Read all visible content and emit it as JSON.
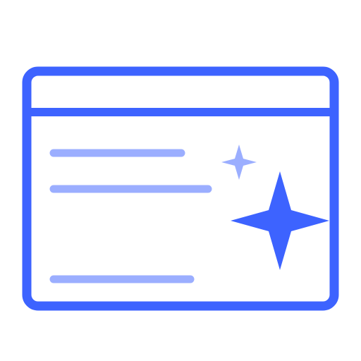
{
  "icon": {
    "name": "browser-window-sparkle-icon",
    "colors": {
      "primary": "#3D63FF",
      "secondary": "#9BAEFF",
      "background": "#FFFFFF"
    }
  }
}
